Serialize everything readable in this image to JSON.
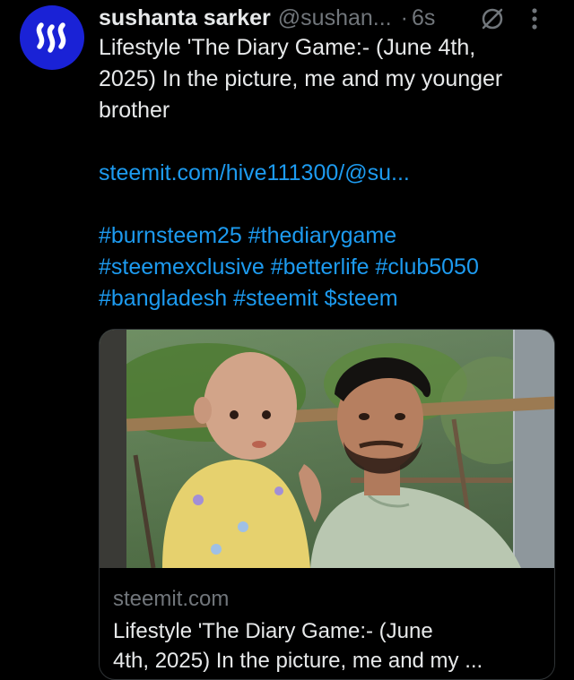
{
  "post": {
    "author_name": "sushanta sarker",
    "handle": "@sushan...",
    "separator": "·",
    "time": "6s",
    "text_lines": [
      "Lifestyle 'The Diary Game:-  (June 4th,",
      "2025) In the picture, me and my younger",
      "brother"
    ],
    "link": "steemit.com/hive111300/@su...",
    "hashtag_lines": [
      "#burnsteem25 #thediarygame",
      "#steemexclusive #betterlife #club5050",
      "#bangladesh #steemit $steem"
    ]
  },
  "card": {
    "domain": "steemit.com",
    "title_lines": [
      "Lifestyle 'The Diary Game:- (June",
      "4th, 2025) In the picture, me and my ..."
    ]
  },
  "icons": {
    "avatar": "steem-logo-icon",
    "status": "circle-slash-icon",
    "more": "more-vertical-icon"
  },
  "colors": {
    "background": "#000000",
    "text": "#e7e9ea",
    "muted": "#71767b",
    "link": "#1d9bf0",
    "avatar": "#1a22d6"
  }
}
